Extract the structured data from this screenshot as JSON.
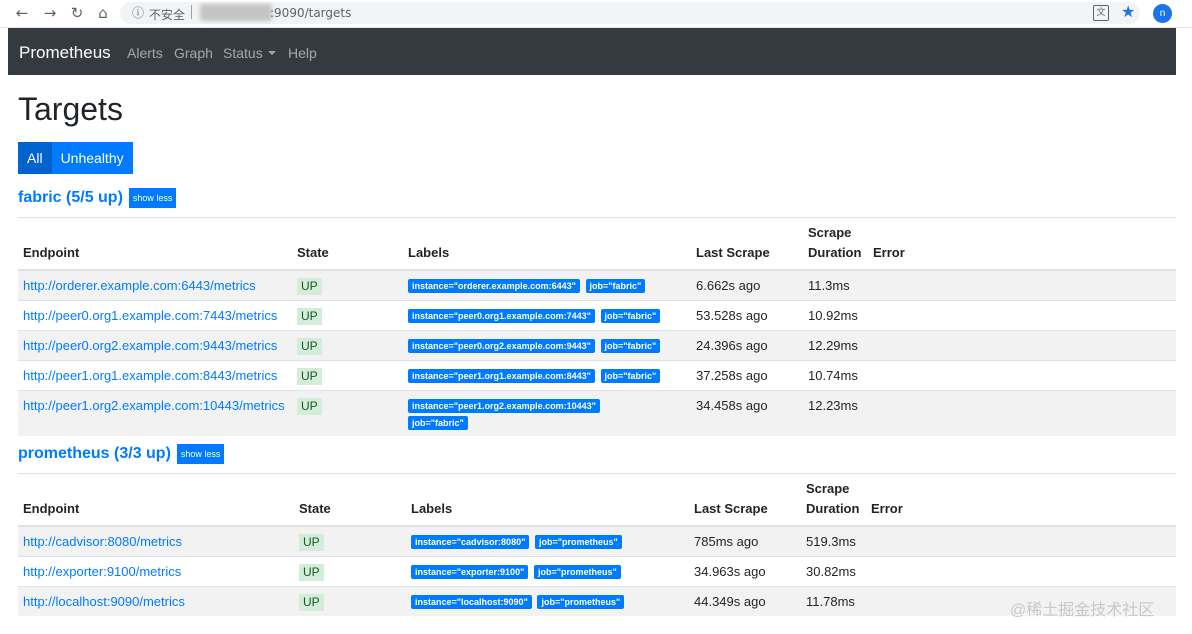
{
  "browser": {
    "security_label": "不安全",
    "url": ":9090/targets"
  },
  "navbar": {
    "brand": "Prometheus",
    "links": [
      "Alerts",
      "Graph",
      "Status",
      "Help"
    ]
  },
  "page": {
    "title": "Targets",
    "filters": [
      "All",
      "Unhealthy"
    ],
    "active_filter": "All"
  },
  "columns": {
    "endpoint": "Endpoint",
    "state": "State",
    "labels": "Labels",
    "last_scrape": "Last Scrape",
    "scrape_duration_1": "Scrape",
    "scrape_duration_2": "Duration",
    "error": "Error"
  },
  "jobs": [
    {
      "title": "fabric (5/5 up)",
      "toggle": "show less",
      "targets": [
        {
          "endpoint": "http://orderer.example.com:6443/metrics",
          "state": "UP",
          "labels": [
            "instance=\"orderer.example.com:6443\"",
            "job=\"fabric\""
          ],
          "last_scrape": "6.662s ago",
          "duration": "11.3ms",
          "error": ""
        },
        {
          "endpoint": "http://peer0.org1.example.com:7443/metrics",
          "state": "UP",
          "labels": [
            "instance=\"peer0.org1.example.com:7443\"",
            "job=\"fabric\""
          ],
          "last_scrape": "53.528s ago",
          "duration": "10.92ms",
          "error": ""
        },
        {
          "endpoint": "http://peer0.org2.example.com:9443/metrics",
          "state": "UP",
          "labels": [
            "instance=\"peer0.org2.example.com:9443\"",
            "job=\"fabric\""
          ],
          "last_scrape": "24.396s ago",
          "duration": "12.29ms",
          "error": ""
        },
        {
          "endpoint": "http://peer1.org1.example.com:8443/metrics",
          "state": "UP",
          "labels": [
            "instance=\"peer1.org1.example.com:8443\"",
            "job=\"fabric\""
          ],
          "last_scrape": "37.258s ago",
          "duration": "10.74ms",
          "error": ""
        },
        {
          "endpoint": "http://peer1.org2.example.com:10443/metrics",
          "state": "UP",
          "labels": [
            "instance=\"peer1.org2.example.com:10443\"",
            "job=\"fabric\""
          ],
          "last_scrape": "34.458s ago",
          "duration": "12.23ms",
          "error": ""
        }
      ]
    },
    {
      "title": "prometheus (3/3 up)",
      "toggle": "show less",
      "targets": [
        {
          "endpoint": "http://cadvisor:8080/metrics",
          "state": "UP",
          "labels": [
            "instance=\"cadvisor:8080\"",
            "job=\"prometheus\""
          ],
          "last_scrape": "785ms ago",
          "duration": "519.3ms",
          "error": ""
        },
        {
          "endpoint": "http://exporter:9100/metrics",
          "state": "UP",
          "labels": [
            "instance=\"exporter:9100\"",
            "job=\"prometheus\""
          ],
          "last_scrape": "34.963s ago",
          "duration": "30.82ms",
          "error": ""
        },
        {
          "endpoint": "http://localhost:9090/metrics",
          "state": "UP",
          "labels": [
            "instance=\"localhost:9090\"",
            "job=\"prometheus\""
          ],
          "last_scrape": "44.349s ago",
          "duration": "11.78ms",
          "error": ""
        }
      ]
    }
  ],
  "watermark": "@稀土掘金技术社区"
}
